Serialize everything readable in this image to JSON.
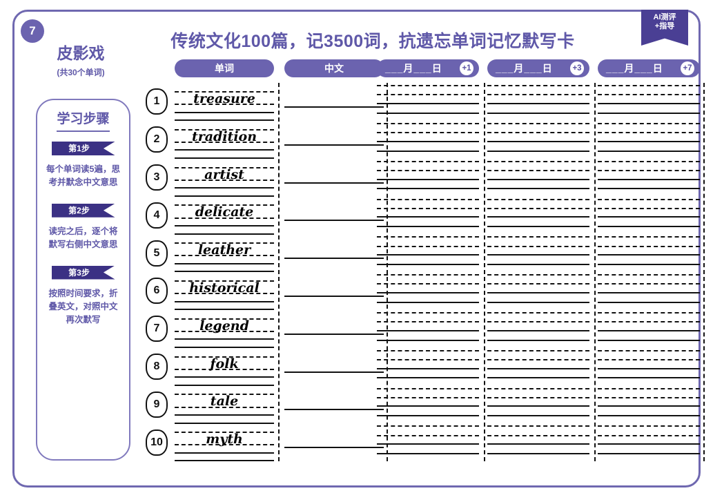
{
  "page": {
    "number": "7",
    "badge": {
      "line1": "AI测评",
      "line2": "+指导"
    },
    "title": "传统文化100篇，记3500词，抗遗忘单词记忆默写卡"
  },
  "sidebar": {
    "topic": "皮影戏",
    "subtitle": "(共30个单词)",
    "steps_heading": "学习步骤",
    "steps": [
      {
        "banner": "第1步",
        "text": "每个单词读5遍，思考并默念中文意思"
      },
      {
        "banner": "第2步",
        "text": "读完之后，逐个将默写右侧中文意思"
      },
      {
        "banner": "第3步",
        "text": "按照时间要求，折叠英文，对照中文再次默写"
      }
    ]
  },
  "table": {
    "headers": {
      "word": "单词",
      "chinese": "中文",
      "date_label": "___月___日",
      "reviews": [
        "+1",
        "+3",
        "+7"
      ]
    },
    "rows": [
      {
        "no": "1",
        "word": "treasure",
        "chinese": ""
      },
      {
        "no": "2",
        "word": "tradition",
        "chinese": ""
      },
      {
        "no": "3",
        "word": "artist",
        "chinese": ""
      },
      {
        "no": "4",
        "word": "delicate",
        "chinese": ""
      },
      {
        "no": "5",
        "word": "leather",
        "chinese": ""
      },
      {
        "no": "6",
        "word": "historical",
        "chinese": ""
      },
      {
        "no": "7",
        "word": "legend",
        "chinese": ""
      },
      {
        "no": "8",
        "word": "folk",
        "chinese": ""
      },
      {
        "no": "9",
        "word": "tale",
        "chinese": ""
      },
      {
        "no": "10",
        "word": "myth",
        "chinese": ""
      }
    ]
  },
  "colors": {
    "frame": "#6f68b0",
    "pill": "#6b63af",
    "banner": "#3b3184",
    "text": "#5f58a8",
    "rule": "#111111"
  }
}
